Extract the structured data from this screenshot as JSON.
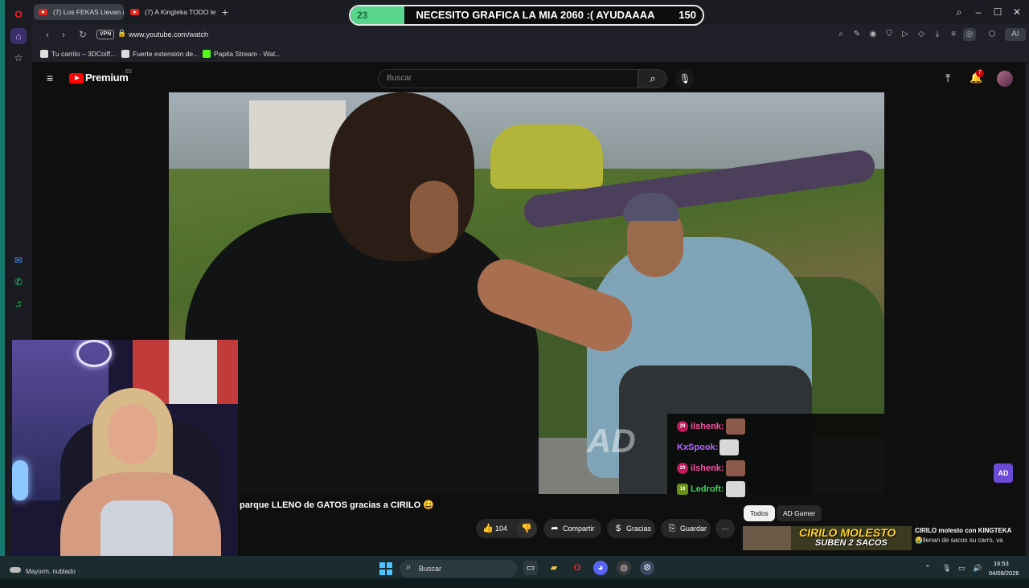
{
  "browser": {
    "tabs": [
      {
        "label": "(7) Los FEKAS Llevan c"
      },
      {
        "label": "(7) A Kingteka TODO les s"
      }
    ],
    "new_tab_icon": "plus-icon",
    "window_controls": [
      "search",
      "minimize",
      "maximize",
      "close"
    ],
    "vpn_label": "VPN",
    "url": "www.youtube.com/watch",
    "bookmarks": [
      {
        "label": "Tu carrito – 3DCoiff..."
      },
      {
        "label": "Fuerte extensión de..."
      },
      {
        "label": "Papita Stream - Wat..."
      }
    ],
    "ai_label": "AI"
  },
  "stream_banner": {
    "count": "23",
    "text": "NECESITO GRAFICA LA MIA 2060 :( AYUDAAAA",
    "goal": "150",
    "progress_fraction": 0.153
  },
  "youtube": {
    "brand": "Premium",
    "region": "ES",
    "search_placeholder": "Buscar",
    "notification_count": "7",
    "video_watermark": "AD",
    "video_title": "parque LLENO de GATOS gracias a CIRILO 😄",
    "actions": {
      "likes": "104",
      "share": "Compartir",
      "thanks": "Gracias",
      "save": "Guardar",
      "more": "⋯"
    },
    "chips": [
      "Todos",
      "AD Gamer"
    ],
    "recommendation": {
      "thumb_line1": "CIRILO MOLESTO",
      "thumb_line2": "SUBEN 2 SACOS",
      "title": "CIRILO molesto con KINGTEKA",
      "subtitle": "😭llenan de sacos su carro, va"
    },
    "corner_logo": "AD"
  },
  "chat_overlay": [
    {
      "badge": "29",
      "user": "ilshenk:",
      "user_color": "#ff4fa3",
      "badge_color": "#c2185b"
    },
    {
      "badge": "",
      "user": "KxSpook:",
      "user_color": "#b46bff",
      "badge_color": ""
    },
    {
      "badge": "29",
      "user": "ilshenk:",
      "user_color": "#ff4fa3",
      "badge_color": "#c2185b"
    },
    {
      "badge": "18",
      "user": "Ledroft:",
      "user_color": "#3fd65a",
      "badge_color": "#6a8f1a"
    }
  ],
  "taskbar": {
    "weather": "Mayorm. nublado",
    "search_placeholder": "Buscar",
    "time": "16:53",
    "date": "04/08/2026"
  }
}
